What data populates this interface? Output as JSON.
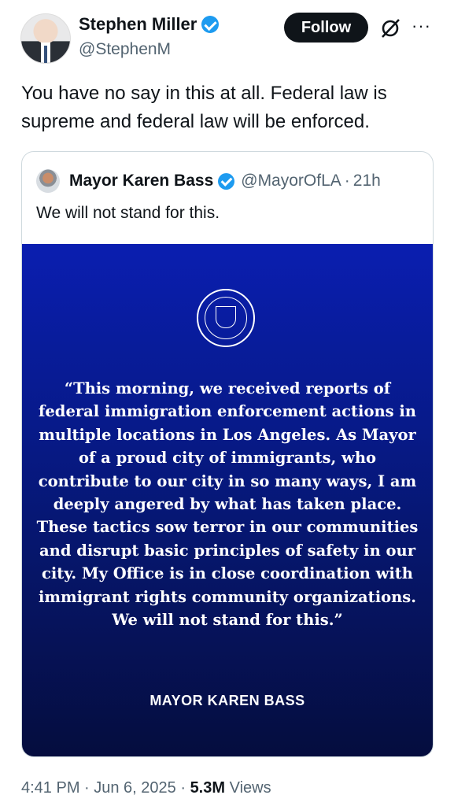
{
  "author": {
    "name": "Stephen Miller",
    "handle": "@StephenM"
  },
  "follow_button": "Follow",
  "more_icon": "···",
  "tweet": {
    "text": "You have no say in this at all. Federal law is supreme and federal law will be enforced."
  },
  "quoted": {
    "name": "Mayor Karen Bass",
    "handle": "@MayorOfLA",
    "separator": "·",
    "time": "21h",
    "text": "We will not stand for this.",
    "image": {
      "quote": "“This morning, we received reports of federal immigration enforcement actions in multiple locations in Los Angeles. As Mayor of a proud city of immigrants, who contribute to our city in so many ways, I am deeply angered by what has taken place. These tactics sow terror in our communities and disrupt basic principles of safety in our city. My Office is in close coordination with immigrant rights community organizations. We will not stand for this.”",
      "signature": "MAYOR KAREN BASS",
      "seal_icon": "city-of-los-angeles-seal"
    }
  },
  "meta": {
    "timestamp": "4:41 PM · Jun 6, 2025 · ",
    "views_count": "5.3M",
    "views_label": "Views"
  },
  "colors": {
    "verified": "#1d9bf0",
    "follow_bg": "#0f1419",
    "muted_text": "#536471",
    "image_top": "#0a1eb0",
    "image_bottom": "#050d3e"
  }
}
